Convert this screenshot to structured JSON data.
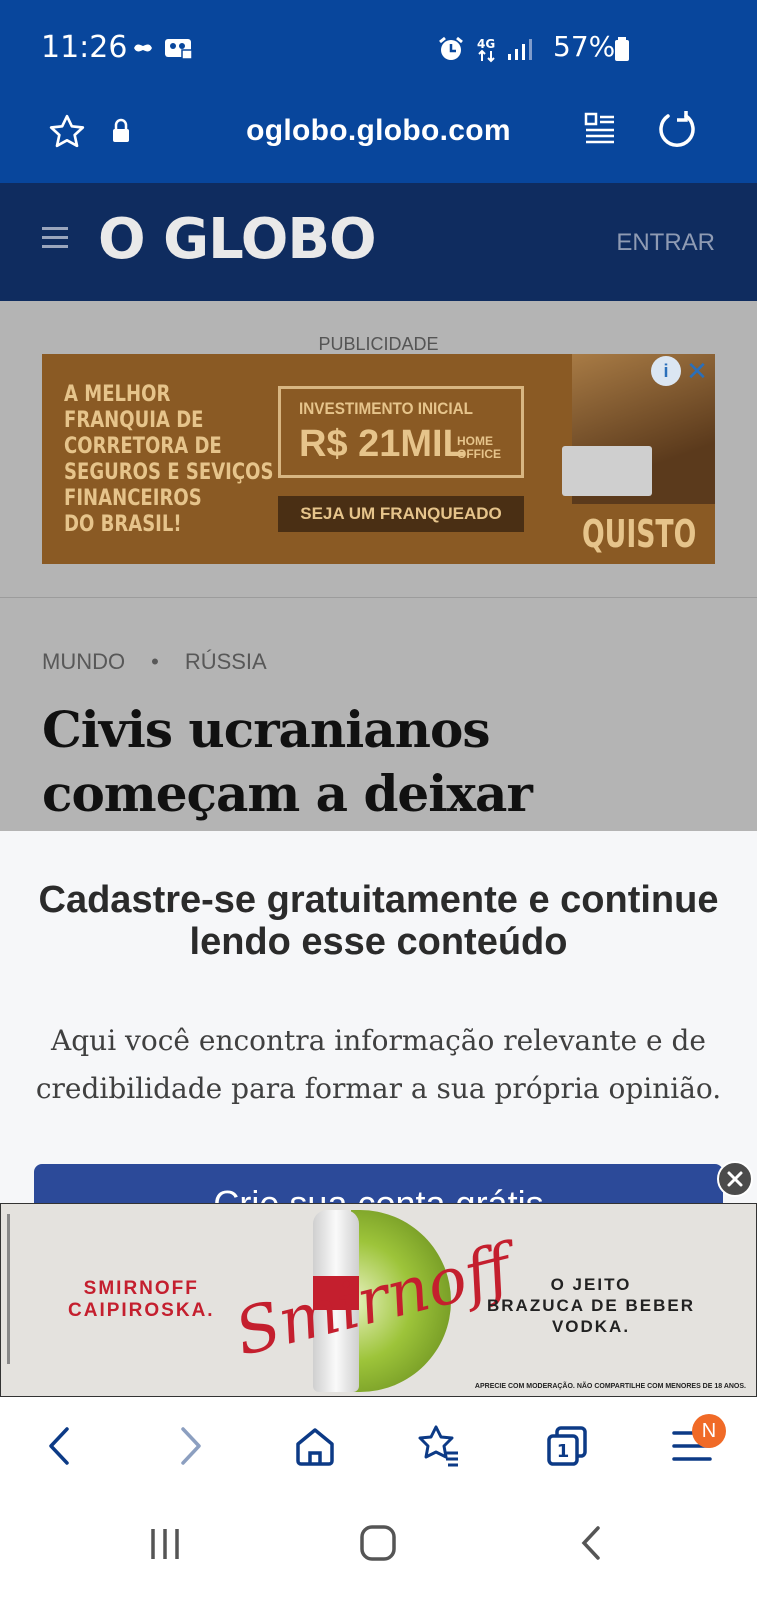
{
  "status_bar": {
    "time": "11:26",
    "battery": "57%"
  },
  "browser": {
    "url": "oglobo.globo.com"
  },
  "site": {
    "logo": "O GLOBO",
    "login": "ENTRAR"
  },
  "ad_top": {
    "label": "PUBLICIDADE",
    "left_text": [
      "A MELHOR",
      "FRANQUIA DE",
      "CORRETORA DE",
      "SEGUROS E SEVIÇOS",
      "FINANCEIROS",
      "DO BRASIL!"
    ],
    "box_title": "INVESTIMENTO INICIAL",
    "box_value": "R$ 21MIL",
    "box_note": [
      "HOME",
      "OFFICE"
    ],
    "cta": "SEJA UM FRANQUEADO",
    "brand": "QUISTO"
  },
  "article": {
    "section": "MUNDO",
    "subsection": "RÚSSIA",
    "headline": "Civis ucranianos começam a deixar cidades sitiadas"
  },
  "paywall": {
    "title": "Cadastre-se gratuitamente e continue lendo esse conteúdo",
    "body": "Aqui você encontra informação relevante e de credibilidade para formar a sua própria opinião.",
    "cta_partial": "Crie sua conta grátis"
  },
  "ad_bottom": {
    "left": [
      "SMIRNOFF",
      "CAIPIROSKA."
    ],
    "script": "Smirnoff",
    "right": [
      "O JEITO",
      "BRAZUCA DE BEBER",
      "VODKA."
    ],
    "fine_print": "APRECIE COM MODERAÇÃO. NÃO COMPARTILHE COM MENORES DE 18 ANOS."
  },
  "toolbar": {
    "tabs_count": "1",
    "menu_badge": "N"
  },
  "colors": {
    "browser_blue": "#08469c",
    "site_navy": "#0f2c5f",
    "cta_blue": "#2c4a99",
    "badge_orange": "#f06a27",
    "smirnoff_red": "#c41f2e"
  }
}
